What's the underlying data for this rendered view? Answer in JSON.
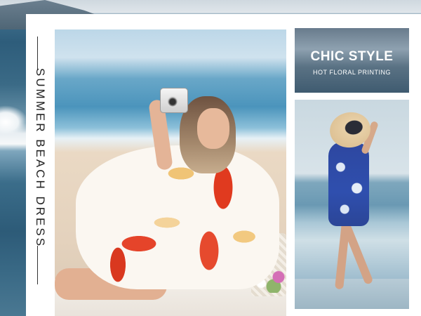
{
  "banner": {
    "vertical_title": "SUMMER BEACH DRESS",
    "headline": "CHIC STYLE",
    "subheadline": "HOT FLORAL PRINTING"
  },
  "colors": {
    "card": "#ffffff",
    "title_text": "#222222",
    "headline_text": "#ffffff",
    "dress_red": "#e03a1f",
    "dress_yellow": "#f0c476",
    "blue_dress": "#2e47a0"
  },
  "images": {
    "main_photo": "woman-in-floral-dress-with-camera",
    "top_right": "ocean-banner-background",
    "bottom_right": "woman-in-blue-dress-with-sun-hat"
  }
}
